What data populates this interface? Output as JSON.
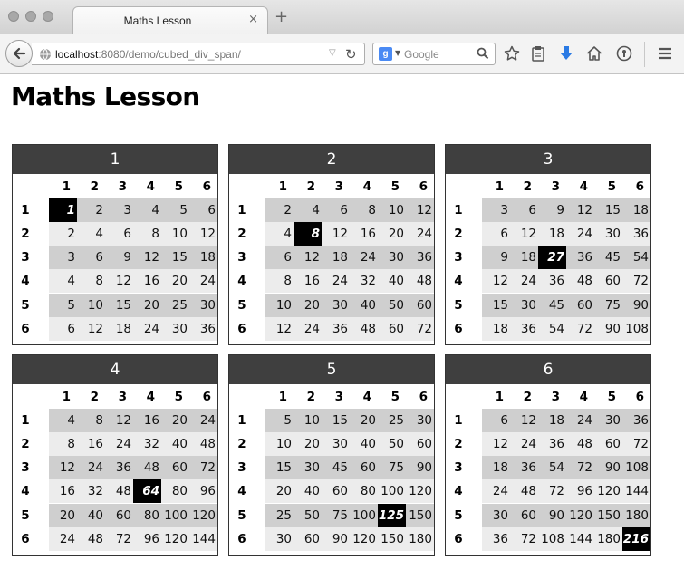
{
  "browser": {
    "tab_title": "Maths Lesson",
    "tab_close": "×",
    "new_tab": "+",
    "url_host": "localhost",
    "url_rest": ":8080/demo/cubed_div_span/",
    "search_engine_letter": "g",
    "search_placeholder": "Google"
  },
  "page": {
    "title": "Maths Lesson"
  },
  "tables": [
    {
      "label": "1",
      "multiplier": 1,
      "highlight": [
        1,
        1
      ]
    },
    {
      "label": "2",
      "multiplier": 2,
      "highlight": [
        2,
        2
      ]
    },
    {
      "label": "3",
      "multiplier": 3,
      "highlight": [
        3,
        3
      ]
    },
    {
      "label": "4",
      "multiplier": 4,
      "highlight": [
        4,
        4
      ]
    },
    {
      "label": "5",
      "multiplier": 5,
      "highlight": [
        5,
        5
      ]
    },
    {
      "label": "6",
      "multiplier": 6,
      "highlight": [
        6,
        6
      ]
    }
  ],
  "header_labels": [
    "1",
    "2",
    "3",
    "4",
    "5",
    "6"
  ],
  "tables_values": [
    [
      [
        1,
        2,
        3,
        4,
        5,
        6
      ],
      [
        2,
        4,
        6,
        8,
        10,
        12
      ],
      [
        3,
        6,
        9,
        12,
        15,
        18
      ],
      [
        4,
        8,
        12,
        16,
        20,
        24
      ],
      [
        5,
        10,
        15,
        20,
        25,
        30
      ],
      [
        6,
        12,
        18,
        24,
        30,
        36
      ]
    ],
    [
      [
        2,
        4,
        6,
        8,
        10,
        12
      ],
      [
        4,
        8,
        12,
        16,
        20,
        24
      ],
      [
        6,
        12,
        18,
        24,
        30,
        36
      ],
      [
        8,
        16,
        24,
        32,
        40,
        48
      ],
      [
        10,
        20,
        30,
        40,
        50,
        60
      ],
      [
        12,
        24,
        36,
        48,
        60,
        72
      ]
    ],
    [
      [
        3,
        6,
        9,
        12,
        15,
        18
      ],
      [
        6,
        12,
        18,
        24,
        30,
        36
      ],
      [
        9,
        18,
        27,
        36,
        45,
        54
      ],
      [
        12,
        24,
        36,
        48,
        60,
        72
      ],
      [
        15,
        30,
        45,
        60,
        75,
        90
      ],
      [
        18,
        36,
        54,
        72,
        90,
        108
      ]
    ],
    [
      [
        4,
        8,
        12,
        16,
        20,
        24
      ],
      [
        8,
        16,
        24,
        32,
        40,
        48
      ],
      [
        12,
        24,
        36,
        48,
        60,
        72
      ],
      [
        16,
        32,
        48,
        64,
        80,
        96
      ],
      [
        20,
        40,
        60,
        80,
        100,
        120
      ],
      [
        24,
        48,
        72,
        96,
        120,
        144
      ]
    ],
    [
      [
        5,
        10,
        15,
        20,
        25,
        30
      ],
      [
        10,
        20,
        30,
        40,
        50,
        60
      ],
      [
        15,
        30,
        45,
        60,
        75,
        90
      ],
      [
        20,
        40,
        60,
        80,
        100,
        120
      ],
      [
        25,
        50,
        75,
        100,
        125,
        150
      ],
      [
        30,
        60,
        90,
        120,
        150,
        180
      ]
    ],
    [
      [
        6,
        12,
        18,
        24,
        30,
        36
      ],
      [
        12,
        24,
        36,
        48,
        60,
        72
      ],
      [
        18,
        36,
        54,
        72,
        90,
        108
      ],
      [
        24,
        48,
        72,
        96,
        120,
        144
      ],
      [
        30,
        60,
        90,
        120,
        150,
        180
      ],
      [
        36,
        72,
        108,
        144,
        180,
        216
      ]
    ]
  ],
  "colors": {
    "header_bar": "#3f3f3f",
    "row_band_dark": "#cfcfcf",
    "row_band_light": "#ececec",
    "cube_highlight": "#000000"
  },
  "icons": [
    "globe-icon",
    "search-icon",
    "star-icon",
    "clipboard-icon",
    "download-icon",
    "home-icon",
    "privacy-icon",
    "menu-icon",
    "back-arrow-icon",
    "reload-icon"
  ]
}
